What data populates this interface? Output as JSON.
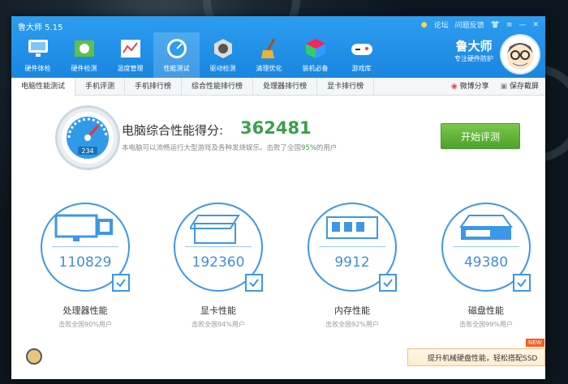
{
  "app": {
    "title": "鲁大师 5.15"
  },
  "titlebar": {
    "forum": "论坛",
    "feedback": "问题反馈"
  },
  "nav": [
    {
      "label": "硬件体检",
      "icon": "monitor-check-icon"
    },
    {
      "label": "硬件检测",
      "icon": "circuit-board-icon"
    },
    {
      "label": "温度管理",
      "icon": "temperature-chart-icon"
    },
    {
      "label": "性能测试",
      "icon": "speedometer-icon"
    },
    {
      "label": "驱动检测",
      "icon": "driver-gear-icon"
    },
    {
      "label": "清理优化",
      "icon": "broom-icon"
    },
    {
      "label": "装机必备",
      "icon": "package-box-icon"
    },
    {
      "label": "游戏库",
      "icon": "gamepad-icon"
    }
  ],
  "brand": {
    "name": "鲁大师",
    "slogan": "专注硬件防护"
  },
  "tabs": [
    "电脑性能测试",
    "手机评测",
    "手机排行榜",
    "综合性能排行榜",
    "处理器排行榜",
    "显卡排行榜"
  ],
  "share": {
    "weibo": "微博分享",
    "screenshot": "保存截屏"
  },
  "score": {
    "title": "电脑综合性能得分:",
    "value": "362481",
    "desc_prefix": "本电脑可以流畅运行大型游戏及各种发烧娱乐。击败了全国",
    "percent": "95%",
    "desc_suffix": "的用户",
    "gauge_text": "234",
    "start": "开始评测"
  },
  "cards": [
    {
      "value": "110829",
      "label": "处理器性能",
      "sub": "击败全国90%用户",
      "icon": "cpu-monitor-icon"
    },
    {
      "value": "192360",
      "label": "显卡性能",
      "sub": "击败全国94%用户",
      "icon": "graphics-card-icon"
    },
    {
      "value": "9912",
      "label": "内存性能",
      "sub": "击败全国92%用户",
      "icon": "memory-chip-icon"
    },
    {
      "value": "49380",
      "label": "磁盘性能",
      "sub": "击败全国99%用户",
      "icon": "hard-disk-icon"
    }
  ],
  "banner": {
    "text": "提升机械硬盘性能，轻松搭配SSD",
    "new": "NEW"
  },
  "colors": {
    "header": "#1a86e0",
    "accent": "#3aa04c",
    "circle": "#3d97e8"
  }
}
